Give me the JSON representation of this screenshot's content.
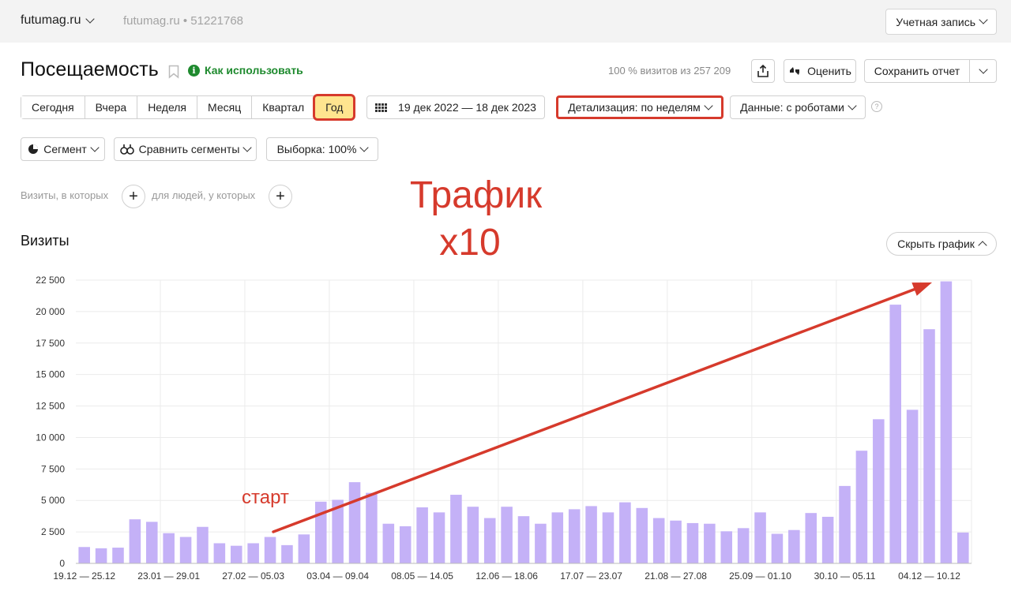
{
  "header": {
    "site": "futumag.ru",
    "site_id": "futumag.ru • 51221768",
    "account": "Учетная запись"
  },
  "page": {
    "title": "Посещаемость",
    "howto": "Как использовать",
    "visits_share": "100 % визитов из 257 209",
    "rate": "Оценить",
    "save_report": "Сохранить отчет"
  },
  "periods": [
    "Сегодня",
    "Вчера",
    "Неделя",
    "Месяц",
    "Квартал",
    "Год"
  ],
  "active_period": "Год",
  "date_range": "19 дек 2022 — 18 дек 2023",
  "detail": "Детализация: по неделям",
  "data_mode": "Данные: с роботами",
  "segment": "Сегмент",
  "compare": "Сравнить сегменты",
  "sample": "Выборка: 100%",
  "filters": {
    "visits_where": "Визиты, в которых",
    "people_where": "для людей, у которых"
  },
  "annotation": {
    "line1": "Трафик",
    "line2": "x10",
    "start": "старт"
  },
  "chart_title": "Визиты",
  "hide_chart": "Скрыть график",
  "colors": {
    "bar": "#c4b1f7",
    "accent": "#d63a2c",
    "active": "#ffe58f"
  },
  "chart_data": {
    "type": "bar",
    "title": "Визиты",
    "ylim": [
      0,
      22500
    ],
    "yticks": [
      0,
      2500,
      5000,
      7500,
      10000,
      12500,
      15000,
      17500,
      20000,
      22500
    ],
    "ytick_labels": [
      "0",
      "2 500",
      "5 000",
      "7 500",
      "10 000",
      "12 500",
      "15 000",
      "17 500",
      "20 000",
      "22 500"
    ],
    "xtick_labels": [
      "19.12 — 25.12",
      "23.01 — 29.01",
      "27.02 — 05.03",
      "03.04 — 09.04",
      "08.05 — 14.05",
      "12.06 — 18.06",
      "17.07 — 23.07",
      "21.08 — 27.08",
      "25.09 — 01.10",
      "30.10 — 05.11",
      "04.12 — 10.12"
    ],
    "xtick_every": 5,
    "grid": true,
    "values": [
      1300,
      1200,
      1250,
      3500,
      3300,
      2400,
      2100,
      2900,
      1600,
      1400,
      1600,
      2100,
      1450,
      2300,
      4900,
      5050,
      6450,
      5600,
      3150,
      2950,
      4450,
      4050,
      5450,
      4500,
      3600,
      4500,
      3750,
      3150,
      4050,
      4300,
      4550,
      4050,
      4850,
      4400,
      3600,
      3400,
      3200,
      3150,
      2550,
      2800,
      4050,
      2350,
      2650,
      4000,
      3700,
      6150,
      8950,
      11450,
      20550,
      12200,
      18600,
      22400,
      2450
    ]
  }
}
